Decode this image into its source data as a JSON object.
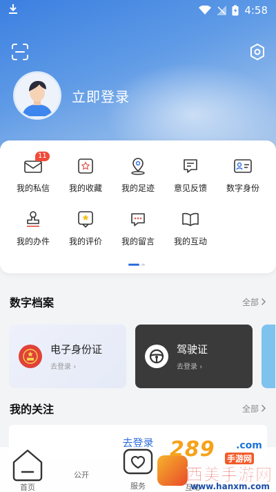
{
  "status_bar": {
    "time": "4:58"
  },
  "profile": {
    "login_label": "立即登录"
  },
  "features": [
    {
      "label": "我的私信",
      "icon": "mail-icon",
      "badge": "11"
    },
    {
      "label": "我的收藏",
      "icon": "star-icon"
    },
    {
      "label": "我的足迹",
      "icon": "location-pin-icon"
    },
    {
      "label": "意见反馈",
      "icon": "feedback-icon"
    },
    {
      "label": "数字身份",
      "icon": "id-card-icon"
    },
    {
      "label": "我的办件",
      "icon": "stamp-icon"
    },
    {
      "label": "我的评价",
      "icon": "rating-icon"
    },
    {
      "label": "我的留言",
      "icon": "message-icon"
    },
    {
      "label": "我的互动",
      "icon": "book-icon"
    }
  ],
  "digital_archive": {
    "title": "数字档案",
    "see_all": "全部",
    "cards": [
      {
        "title": "电子身份证",
        "subtitle": "去登录"
      },
      {
        "title": "驾驶证",
        "subtitle": "去登录"
      }
    ]
  },
  "my_follow": {
    "title": "我的关注",
    "see_all": "全部",
    "login_prompt": "去登录"
  },
  "tabbar": {
    "tabs": [
      {
        "label": "首页"
      },
      {
        "label": "公开"
      },
      {
        "label": "服务"
      },
      {
        "label": "互动"
      }
    ]
  },
  "watermark": {
    "number": "289",
    "domain_suffix": ".com",
    "tag": "手游网",
    "site_name": "西美手游网",
    "url": "www.hanxm.com"
  }
}
